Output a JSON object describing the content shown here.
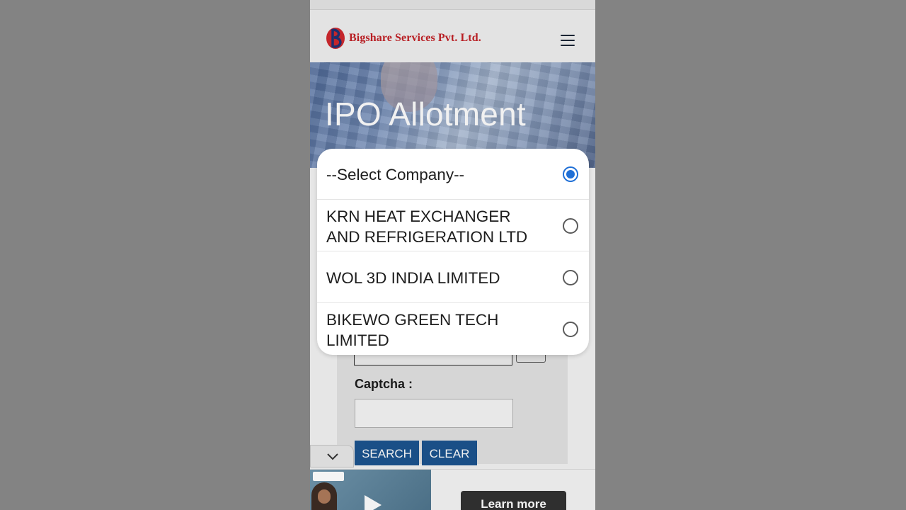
{
  "header": {
    "company_name": "Bigshare Services Pvt. Ltd.",
    "menu_icon": "hamburger-menu-icon",
    "brand_color": "#b81f24"
  },
  "hero": {
    "title": "IPO Allotment"
  },
  "form": {
    "captcha_label": "Captcha :",
    "captcha_value": "",
    "search_label": "SEARCH",
    "clear_label": "CLEAR",
    "button_color": "#1a4f87"
  },
  "ad": {
    "learn_more_label": "Learn more"
  },
  "dialog": {
    "selected_index": 0,
    "accent_color": "#1f6fd6",
    "options": [
      {
        "label": "--Select Company--"
      },
      {
        "label": "KRN HEAT EXCHANGER AND REFRIGERATION LTD"
      },
      {
        "label": "WOL 3D INDIA LIMITED"
      },
      {
        "label": "BIKEWO GREEN TECH LIMITED"
      }
    ]
  }
}
